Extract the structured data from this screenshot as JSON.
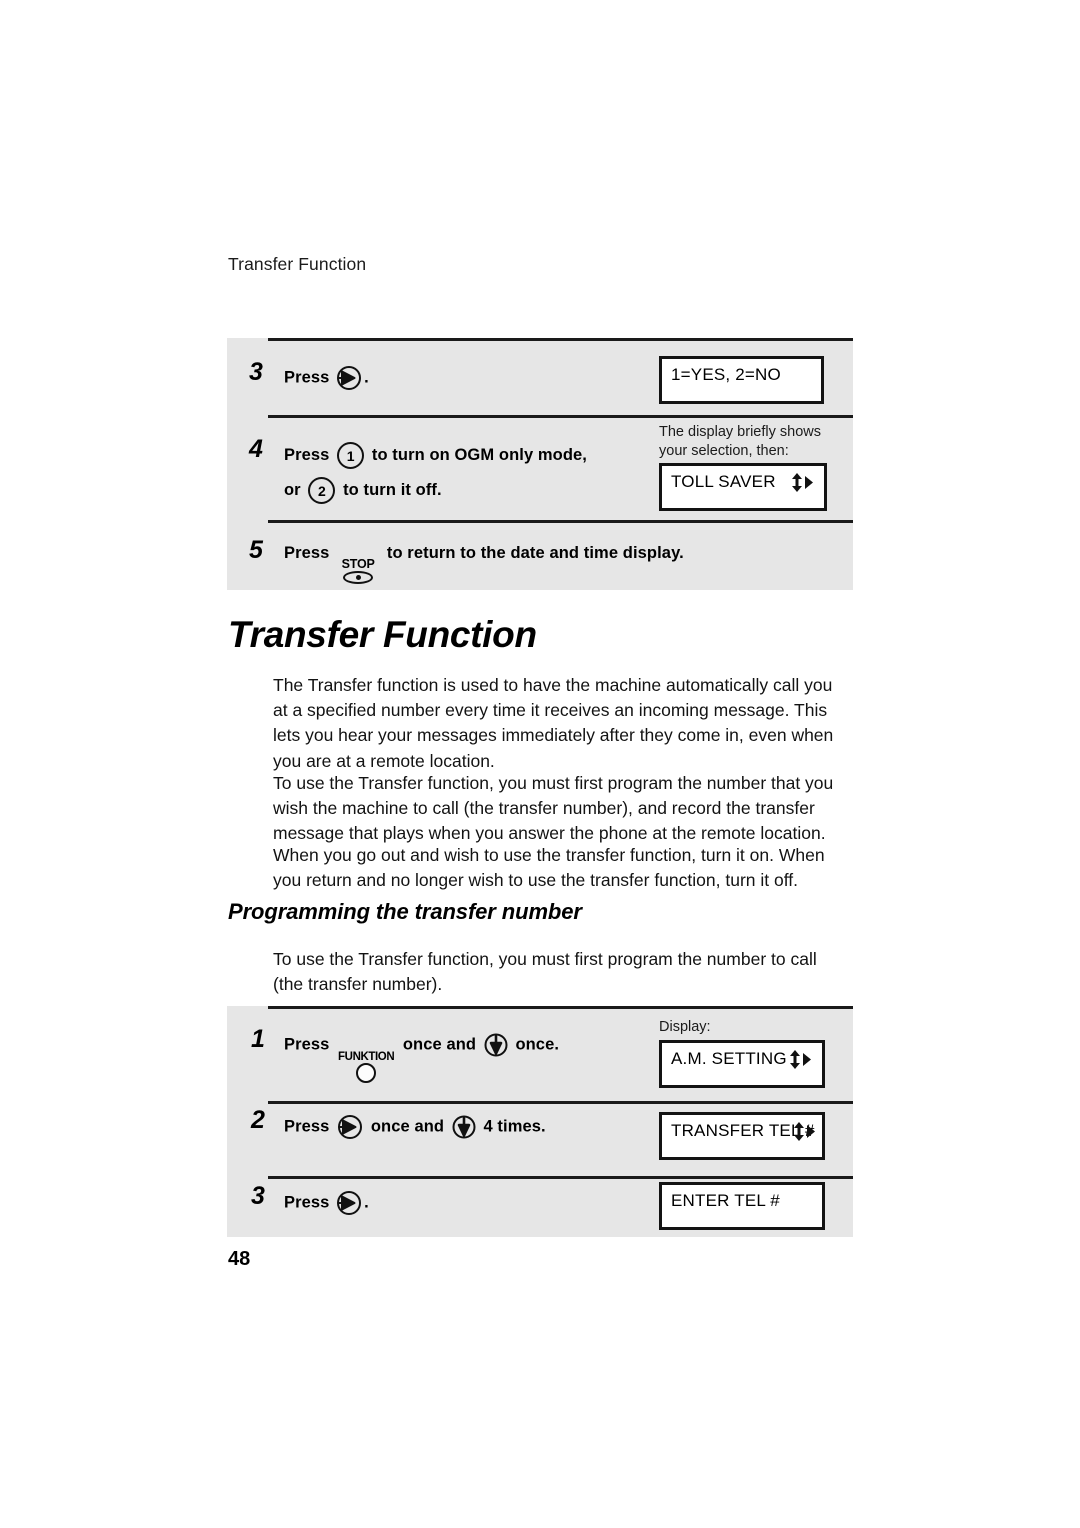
{
  "document": {
    "running_head": "Transfer Function",
    "page_number": "48",
    "title": "Transfer Function",
    "subtitle": "Programming the transfer number"
  },
  "body_paragraphs": {
    "p1": "The Transfer function is used to have the machine automatically call you at a specified number every time it receives an incoming message. This lets you hear your messages immediately after they come in, even when you are at a remote location.",
    "p2": "To use the Transfer function, you must first program the number that you wish the machine to call (the transfer number), and record the transfer message that plays when you answer the phone at the remote location.",
    "p3": "When you go out and wish to use the transfer function, turn it on. When you return and no longer wish to use the transfer function, turn it off.",
    "p4": "To use the Transfer function, you must first program the number to call (the transfer number)."
  },
  "top_panel": {
    "steps": [
      {
        "number": "3",
        "press_label": "Press",
        "trailing": ".",
        "icon": "start-arrow-right-icon",
        "display": {
          "text": "1=YES, 2=NO",
          "arrows": false
        }
      },
      {
        "number": "4",
        "press_label": "Press",
        "key1": "1",
        "text1": "to turn on OGM only mode,",
        "or_label": "or",
        "key2": "2",
        "text2": "to turn it off.",
        "caption": "The display briefly shows your selection, then:",
        "display": {
          "text": "TOLL SAVER",
          "arrows": true
        }
      },
      {
        "number": "5",
        "press_label": "Press",
        "icon": "stop-key-icon",
        "stop_label": "STOP",
        "text": "to return to the date and time display."
      }
    ]
  },
  "bottom_panel": {
    "steps": [
      {
        "number": "1",
        "press_label": "Press",
        "funktion_label": "FUNKTION",
        "mid_text": "once and",
        "end_text": "once.",
        "caption": "Display:",
        "display": {
          "text": "A.M. SETTING",
          "arrows": true
        }
      },
      {
        "number": "2",
        "press_label": "Press",
        "mid_text": "once and",
        "end_text": "4 times.",
        "display": {
          "text": "TRANSFER TEL #",
          "arrows": true
        }
      },
      {
        "number": "3",
        "press_label": "Press",
        "trailing": ".",
        "display": {
          "text": "ENTER TEL #",
          "arrows": false
        }
      }
    ]
  },
  "colors": {
    "panel_background": "#e6e6e6",
    "ink": "#000000",
    "page_background": "#ffffff"
  }
}
